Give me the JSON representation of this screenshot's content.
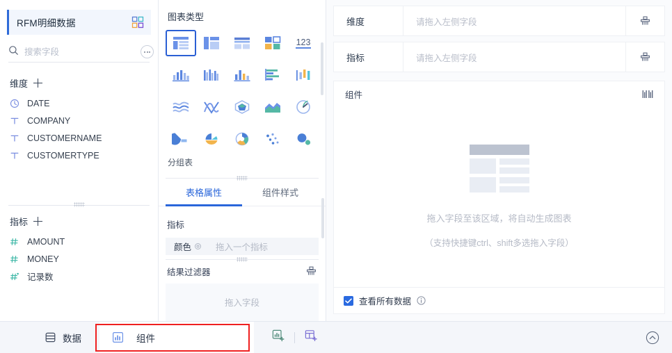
{
  "dataset": {
    "title": "RFM明细数据",
    "icon": "dataset-switch-icon"
  },
  "search": {
    "placeholder": "搜索字段",
    "value": "",
    "icon": "search-icon",
    "more_icon": "more-options-icon"
  },
  "dimensions": {
    "label": "维度",
    "add_label": "+",
    "fields": [
      {
        "name": "DATE",
        "type": "date"
      },
      {
        "name": "COMPANY",
        "type": "text"
      },
      {
        "name": "CUSTOMERNAME",
        "type": "text"
      },
      {
        "name": "CUSTOMERTYPE",
        "type": "text"
      }
    ]
  },
  "metrics": {
    "label": "指标",
    "add_label": "+",
    "fields": [
      {
        "name": "AMOUNT",
        "type": "number"
      },
      {
        "name": "MONEY",
        "type": "number"
      },
      {
        "name": "记录数",
        "type": "number-calc"
      }
    ]
  },
  "chart_panel": {
    "title": "图表类型",
    "selected_type_name": "分组表",
    "selected_index": 0,
    "types": [
      {
        "name": "grouped-table",
        "icon": "table-grouped-icon"
      },
      {
        "name": "cross-table",
        "icon": "table-cross-icon"
      },
      {
        "name": "detail-table",
        "icon": "table-detail-icon"
      },
      {
        "name": "card-table",
        "icon": "table-card-icon"
      },
      {
        "name": "kpi-number",
        "icon": "number-123-icon"
      },
      {
        "name": "column-chart",
        "icon": "column-chart-icon"
      },
      {
        "name": "multi-column",
        "icon": "multi-column-icon"
      },
      {
        "name": "combo-column",
        "icon": "combo-column-icon"
      },
      {
        "name": "bar-chart",
        "icon": "bar-chart-icon"
      },
      {
        "name": "range-column",
        "icon": "range-column-icon"
      },
      {
        "name": "area-wave",
        "icon": "area-wave-icon"
      },
      {
        "name": "line-cross",
        "icon": "line-cross-icon"
      },
      {
        "name": "radar-chart",
        "icon": "radar-chart-icon"
      },
      {
        "name": "stacked-area",
        "icon": "stacked-area-icon"
      },
      {
        "name": "gauge-chart",
        "icon": "gauge-chart-icon"
      },
      {
        "name": "pie-chart",
        "icon": "pie-chart-icon"
      },
      {
        "name": "rose-chart",
        "icon": "rose-chart-icon"
      },
      {
        "name": "sunburst-chart",
        "icon": "sunburst-chart-icon"
      },
      {
        "name": "scatter-chart",
        "icon": "scatter-chart-icon"
      },
      {
        "name": "bubble-chart",
        "icon": "bubble-chart-icon"
      }
    ],
    "tabs": [
      {
        "label": "表格属性",
        "active": true
      },
      {
        "label": "组件样式",
        "active": false
      }
    ],
    "metric_section_label": "指标",
    "color_slot": {
      "key": "颜色",
      "placeholder": "拖入一个指标",
      "settings_icon": "settings-gear-icon"
    },
    "filter_section": {
      "label": "结果过滤器",
      "clear_icon": "clear-broom-icon",
      "drop_placeholder": "拖入字段"
    }
  },
  "shelves": [
    {
      "label": "维度",
      "placeholder": "请拖入左侧字段",
      "clear_icon": "clear-broom-icon"
    },
    {
      "label": "指标",
      "placeholder": "请拖入左侧字段",
      "clear_icon": "clear-broom-icon"
    }
  ],
  "canvas": {
    "title": "组件",
    "toolbar_icon": "chart-bars-icon",
    "empty_line1": "拖入字段至该区域，将自动生成图表",
    "empty_line2": "（支持快捷键ctrl、shift多选拖入字段）",
    "checkbox": {
      "label": "查看所有数据",
      "checked": true,
      "info_icon": "info-circle-icon"
    }
  },
  "bottom_bar": {
    "tabs": [
      {
        "label": "数据",
        "icon": "database-icon",
        "active": false
      },
      {
        "label": "组件",
        "icon": "component-chart-icon",
        "active": true
      }
    ],
    "actions": [
      {
        "name": "add-chart-button",
        "icon": "add-chart-icon"
      },
      {
        "name": "add-component-button",
        "icon": "add-component-icon"
      }
    ],
    "collapse_icon": "chevron-up-circle-icon"
  },
  "colors": {
    "accent": "#2a66da",
    "selected_border": "#2a5fd4",
    "highlight_box": "#ef2020",
    "dimension_icon": "#7b8ee0",
    "metric_icon": "#3cb7a6",
    "panel_bg": "#fafbfd"
  }
}
